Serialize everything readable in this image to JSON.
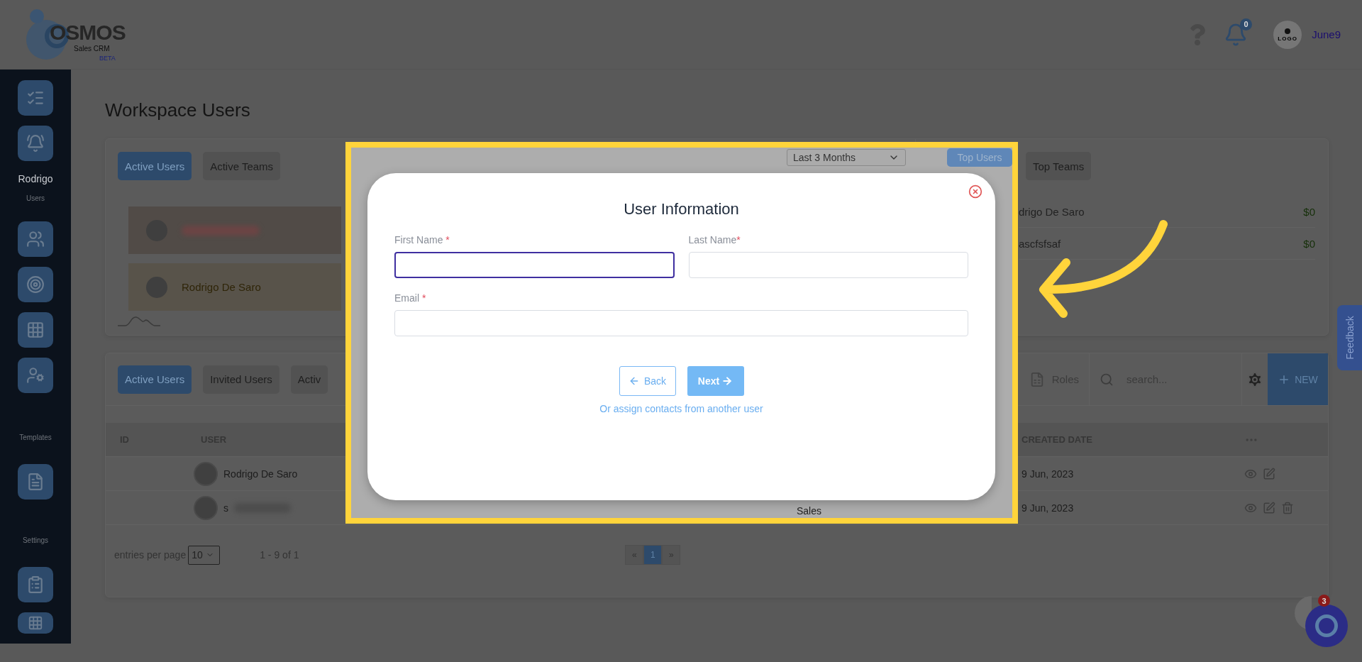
{
  "header": {
    "logo": {
      "name": "OSMOS",
      "subtitle": "Sales CRM",
      "badge": "BETA"
    },
    "notifications": "0",
    "avatar_label": "LOGO",
    "user": "June9"
  },
  "sidebar": {
    "user_label": "Rodrigo",
    "users_caption": "Users",
    "templates_caption": "Templates",
    "settings_caption": "Settings"
  },
  "page_title": "Workspace Users",
  "overview": {
    "tabs": [
      {
        "label": "Active Users",
        "selected": true
      },
      {
        "label": "Active Teams",
        "selected": false
      }
    ],
    "leaders": [
      {
        "kind": "blurred"
      },
      {
        "kind": "named",
        "name": "Rodrigo De Saro"
      }
    ],
    "period": "Last 3 Months",
    "top_tabs": [
      {
        "label": "Top Users",
        "selected": true
      },
      {
        "label": "Top Teams",
        "selected": false
      }
    ],
    "top_list": [
      {
        "name": "drigo De Saro",
        "amount": "$0"
      },
      {
        "name": "ascfsfsaf",
        "amount": "$0"
      }
    ]
  },
  "users": {
    "tabs": [
      {
        "label": "Active Users",
        "selected": true
      },
      {
        "label": "Invited Users",
        "selected": false
      },
      {
        "label": "Activ",
        "selected": false
      }
    ],
    "roles": "Roles",
    "search": {
      "placeholder": "search..."
    },
    "new_button": "NEW",
    "columns": [
      "ID",
      "USER",
      "CREATED DATE"
    ],
    "rows": [
      {
        "user": "Rodrigo De Saro",
        "blurred": false,
        "created": "9 Jun, 2023",
        "deletable": false
      },
      {
        "user": "s",
        "blurred": true,
        "role": "Sales",
        "created": "9 Jun, 2023",
        "deletable": true
      }
    ],
    "pagination": {
      "entries_label": "entries per page",
      "page_size": "10",
      "range": "1 - 9 of 1",
      "pages": [
        {
          "label": "«",
          "selected": false
        },
        {
          "label": "1",
          "selected": true
        },
        {
          "label": "»",
          "selected": false
        }
      ]
    }
  },
  "modal": {
    "title": "User Information",
    "fields": [
      {
        "label": "First Name",
        "mark": " *",
        "focused": true
      },
      {
        "label": "Last Name",
        "mark": "*",
        "focused": false
      },
      {
        "label": "Email",
        "mark": " *",
        "focused": false
      }
    ],
    "back": "Back",
    "next": "Next",
    "link": "Or assign contacts from another user"
  },
  "feedback": "Feedback",
  "chat_badge": "3"
}
